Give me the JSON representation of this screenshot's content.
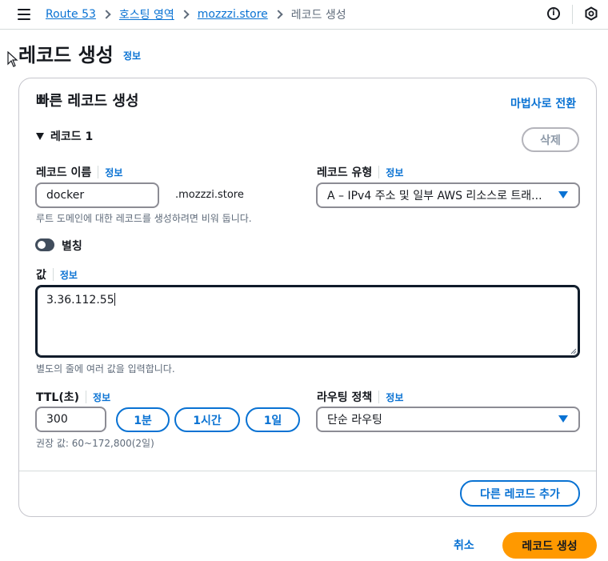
{
  "breadcrumb": {
    "items": [
      "Route 53",
      "호스팅 영역",
      "mozzzi.store"
    ],
    "current": "레코드 생성"
  },
  "header_icons": [
    "info-circle-icon",
    "cloudshell-hex-icon",
    "menu-icon"
  ],
  "page": {
    "title": "레코드 생성",
    "info_link": "정보"
  },
  "quick_create": {
    "title": "빠른 레코드 생성",
    "wizard_link": "마법사로 전환"
  },
  "record": {
    "header": "레코드 1",
    "delete_label": "삭제",
    "name_label": "레코드 이름",
    "name_info": "정보",
    "name_value": "docker",
    "domain_suffix": ".mozzzi.store",
    "name_hint": "루트 도메인에 대한 레코드를 생성하려면 비워 둡니다.",
    "type_label": "레코드 유형",
    "type_info": "정보",
    "type_value": "A – IPv4 주소 및 일부 AWS 리소스로 트래...",
    "alias_label": "별칭",
    "alias_enabled": false,
    "value_label": "값",
    "value_info": "정보",
    "value_text": "3.36.112.55",
    "value_hint": "별도의 줄에 여러 값을 입력합니다.",
    "ttl_label": "TTL(초)",
    "ttl_info": "정보",
    "ttl_value": "300",
    "ttl_presets": [
      "1분",
      "1시간",
      "1일"
    ],
    "ttl_hint": "권장 값: 60~172,800(2일)",
    "routing_label": "라우팅 정책",
    "routing_info": "정보",
    "routing_value": "단순 라우팅"
  },
  "add_record_label": "다른 레코드 추가",
  "footer": {
    "cancel_label": "취소",
    "create_label": "레코드 생성"
  },
  "colors": {
    "link": "#0972d3",
    "primary_button": "#ff9900",
    "text": "#16191f",
    "muted": "#5f6b7a"
  }
}
